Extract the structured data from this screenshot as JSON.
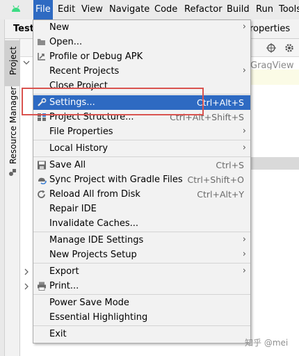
{
  "menubar": {
    "items": [
      "File",
      "Edit",
      "View",
      "Navigate",
      "Code",
      "Refactor",
      "Build",
      "Run",
      "Tools"
    ],
    "active": "File"
  },
  "window": {
    "tab_title": "Test",
    "properties_fragment": "roperties",
    "grag_fragment": "GragView"
  },
  "tool_window_labels": {
    "project": "Project",
    "resource_manager": "Resource Manager"
  },
  "file_menu": {
    "new": {
      "label": "New"
    },
    "open": {
      "label": "Open..."
    },
    "profile_apk": {
      "label": "Profile or Debug APK"
    },
    "recent_projects": {
      "label": "Recent Projects"
    },
    "close_project": {
      "label": "Close Project"
    },
    "settings": {
      "label": "Settings...",
      "shortcut": "Ctrl+Alt+S"
    },
    "project_structure": {
      "label": "Project Structure...",
      "shortcut": "Ctrl+Alt+Shift+S"
    },
    "file_properties": {
      "label": "File Properties"
    },
    "local_history": {
      "label": "Local History"
    },
    "save_all": {
      "label": "Save All",
      "shortcut": "Ctrl+S"
    },
    "sync_gradle": {
      "label": "Sync Project with Gradle Files",
      "shortcut": "Ctrl+Shift+O"
    },
    "reload_disk": {
      "label": "Reload All from Disk",
      "shortcut": "Ctrl+Alt+Y"
    },
    "repair_ide": {
      "label": "Repair IDE"
    },
    "invalidate_caches": {
      "label": "Invalidate Caches..."
    },
    "manage_ide_settings": {
      "label": "Manage IDE Settings"
    },
    "new_projects_setup": {
      "label": "New Projects Setup"
    },
    "export": {
      "label": "Export"
    },
    "print": {
      "label": "Print..."
    },
    "power_save": {
      "label": "Power Save Mode"
    },
    "essential_highlighting": {
      "label": "Essential Highlighting"
    },
    "exit": {
      "label": "Exit"
    }
  },
  "icons": {
    "android": "android-icon",
    "open": "folder-icon",
    "profile": "profile-arrow-icon",
    "settings": "wrench-icon",
    "project_structure": "project-structure-icon",
    "save": "save-icon",
    "sync": "gradle-sync-icon",
    "reload": "reload-icon",
    "print": "printer-icon"
  },
  "colors": {
    "highlight": "#2e6ac2",
    "annotation_box": "#d9534f",
    "menu_bg": "#f2f2f2"
  },
  "watermark": "知乎 @mei"
}
